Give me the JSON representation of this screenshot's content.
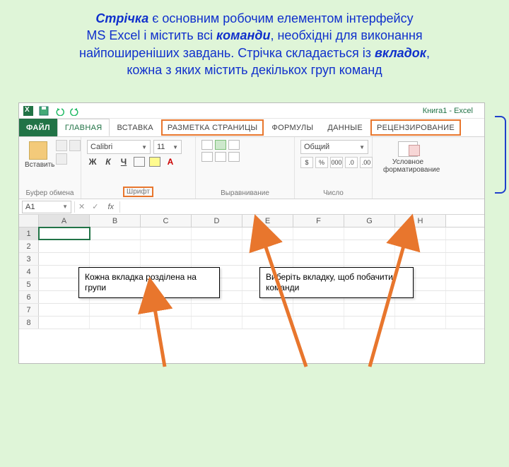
{
  "intro": {
    "t1a": "Стрічка",
    "t1b": " є основним робочим елементом інтерфейсу",
    "t2a": "MS Excel і містить всі ",
    "t2b": "команди",
    "t2c": ", необхідні для виконання",
    "t3a": "найпоширеніших завдань. Стрічка складається із ",
    "t3b": "вкладок",
    "t3c": ",",
    "t4": "кожна з яких містить декількох груп команд"
  },
  "qat": {
    "title": "Книга1 - Excel"
  },
  "tabs": {
    "file": "ФАЙЛ",
    "home": "ГЛАВНАЯ",
    "insert": "ВСТАВКА",
    "layout": "РАЗМЕТКА СТРАНИЦЫ",
    "formulas": "ФОРМУЛЫ",
    "data": "ДАННЫЕ",
    "review": "РЕЦЕНЗИРОВАНИЕ"
  },
  "ribbon": {
    "clipboard": {
      "paste": "Вставить",
      "label": "Буфер обмена"
    },
    "font": {
      "name": "Calibri",
      "size": "11",
      "label": "Шрифт",
      "bold": "Ж",
      "italic": "К",
      "underline": "Ч"
    },
    "alignment": {
      "label": "Выравнивание"
    },
    "number": {
      "format": "Общий",
      "label": "Число",
      "pct": "%",
      "comma": "000"
    },
    "cond": {
      "label1": "Условное",
      "label2": "форматирование"
    }
  },
  "formula_bar": {
    "cell": "A1",
    "fx": "fx"
  },
  "columns": [
    "A",
    "B",
    "C",
    "D",
    "E",
    "F",
    "G",
    "H"
  ],
  "rows": [
    "1",
    "2",
    "3",
    "4",
    "5",
    "6",
    "7",
    "8"
  ],
  "callouts": {
    "left": "Кожна вкладка розділена на групи",
    "right": "Виберіть вкладку, щоб побачити команди"
  }
}
